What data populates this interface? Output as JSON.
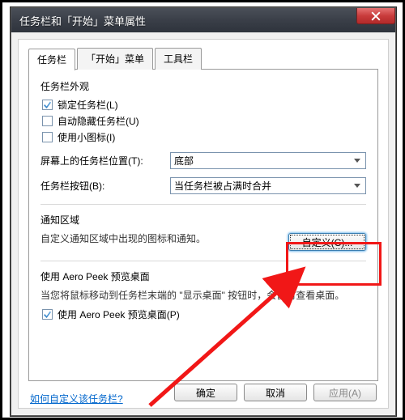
{
  "window": {
    "title": "任务栏和「开始」菜单属性"
  },
  "tabs": [
    {
      "label": "任务栏",
      "active": true
    },
    {
      "label": "「开始」菜单",
      "active": false
    },
    {
      "label": "工具栏",
      "active": false
    }
  ],
  "appearance": {
    "group_label": "任务栏外观",
    "lock": {
      "label": "锁定任务栏(L)",
      "checked": true
    },
    "autohide": {
      "label": "自动隐藏任务栏(U)",
      "checked": false
    },
    "smallicons": {
      "label": "使用小图标(I)",
      "checked": false
    }
  },
  "position": {
    "label": "屏幕上的任务栏位置(T):",
    "value": "底部"
  },
  "buttons": {
    "label": "任务栏按钮(B):",
    "value": "当任务栏被占满时合并"
  },
  "notify": {
    "group_label": "通知区域",
    "desc": "自定义通知区域中出现的图标和通知。",
    "customize_btn": "自定义(C)..."
  },
  "aeropeek": {
    "group_label": "使用 Aero Peek 预览桌面",
    "desc": "当您将鼠标移动到任务栏末端的 \"显示桌面\" 按钮时，会暂时查看桌面。",
    "chk": {
      "label": "使用 Aero Peek 预览桌面(P)",
      "checked": true
    }
  },
  "help_link": "如何自定义该任务栏?",
  "dialog_buttons": {
    "ok": "确定",
    "cancel": "取消",
    "apply": "应用(A)"
  }
}
